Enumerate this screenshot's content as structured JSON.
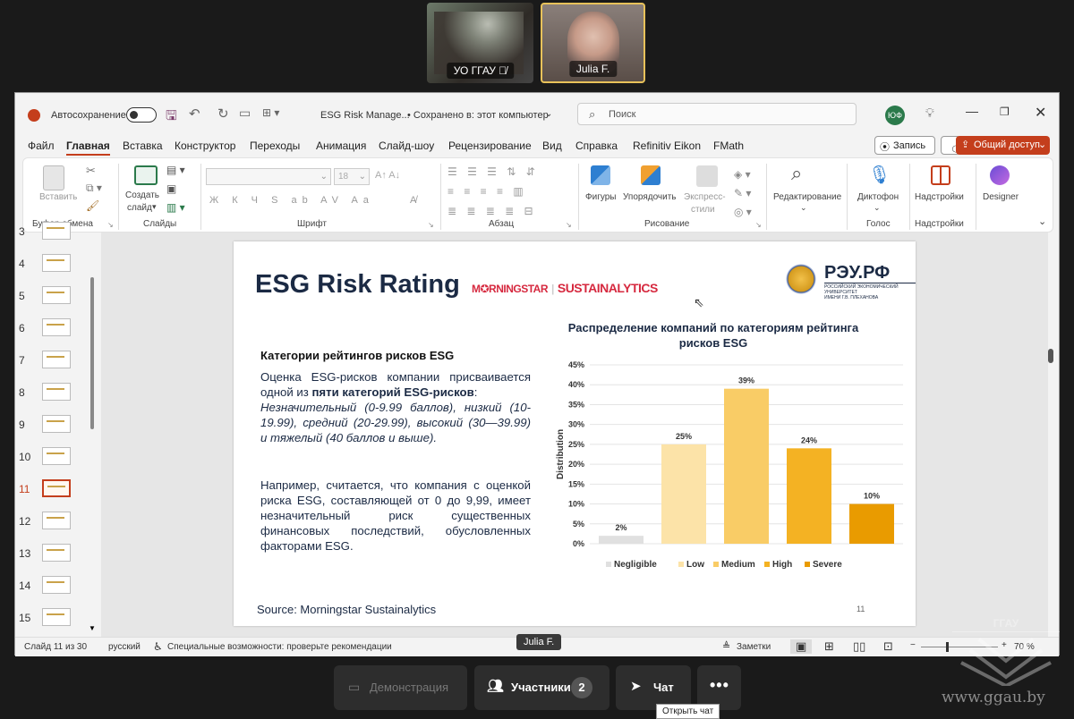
{
  "participants": [
    {
      "name": "УО ГГАУ"
    },
    {
      "name": "Julia F."
    }
  ],
  "titlebar": {
    "autosave": "Автосохранение",
    "filename": "ESG Risk Manage...",
    "saved": "• Сохранено в: этот компьютер",
    "search_placeholder": "Поиск",
    "avatar": "ЮФ"
  },
  "menu": [
    "Файл",
    "Главная",
    "Вставка",
    "Конструктор",
    "Переходы",
    "Анимация",
    "Слайд-шоу",
    "Рецензирование",
    "Вид",
    "Справка",
    "Refinitiv Eikon",
    "FMath"
  ],
  "record_label": "Запись",
  "share_label": "Общий доступ",
  "ribbon": {
    "paste": "Вставить",
    "clipboard": "Буфер обмена",
    "new_slide_1": "Создать",
    "new_slide_2": "слайд",
    "slides": "Слайды",
    "font_size": "18",
    "font_group": "Шрифт",
    "paragraph": "Абзац",
    "shapes": "Фигуры",
    "arrange": "Упорядочить",
    "express_1": "Экспресс-",
    "express_2": "стили",
    "drawing": "Рисование",
    "editing": "Редактирование",
    "dictate": "Диктофон",
    "voice": "Голос",
    "addins": "Надстройки",
    "addins_group": "Надстройки",
    "designer": "Designer"
  },
  "thumbs": [
    "3",
    "4",
    "5",
    "6",
    "7",
    "8",
    "9",
    "10",
    "11",
    "12",
    "13",
    "14",
    "15"
  ],
  "slide": {
    "title": "ESG Risk Rating",
    "logo_morningstar": "M✪RNINGSTAR",
    "logo_sustain": "SUSTAINALYTICS",
    "logo_reu": "РЭУ.РФ",
    "logo_reu_sub1": "РОССИЙСКИЙ ЭКОНОМИЧЕСКИЙ УНИВЕРСИТЕТ",
    "logo_reu_sub2": "ИМЕНИ Г.В. ПЛЕХАНОВА",
    "heading": "Категории рейтингов рисков ESG",
    "p1a": "Оценка ESG-рисков компании присваивается одной из ",
    "p1b": "пяти категорий ESG-рисков",
    "p1c": ":",
    "p1d": "Незначительный (0-9.99 баллов), низкий (10-19.99), средний (20-29.99), высокий (30—39.99) и тяжелый (40 баллов и выше).",
    "p2": "Например, считается, что компания с оценкой риска ESG, составляющей от 0 до 9,99, имеет незначительный риск существенных финансовых последствий, обусловленных факторами ESG.",
    "source": "Source: Morningstar Sustainalytics",
    "page": "11"
  },
  "chart_data": {
    "type": "bar",
    "title": "Распределение компаний по категориям рейтинга рисков ESG",
    "ylabel": "Distribution",
    "categories": [
      "Negligible",
      "Low",
      "Medium",
      "High",
      "Severe"
    ],
    "values": [
      2,
      25,
      39,
      24,
      10
    ],
    "data_labels": [
      "2%",
      "25%",
      "39%",
      "24%",
      "10%"
    ],
    "ylim": [
      0,
      45
    ],
    "yticks": [
      "0%",
      "5%",
      "10%",
      "15%",
      "20%",
      "25%",
      "30%",
      "35%",
      "40%",
      "45%"
    ],
    "colors": [
      "#e0e0e0",
      "#fce3a8",
      "#f9cc66",
      "#f4b223",
      "#e99b00"
    ],
    "grid": true,
    "legend": "bottom"
  },
  "status": {
    "slide": "Слайд 11 из 30",
    "lang": "русский",
    "access": "Специальные возможности: проверьте рекомендации",
    "notes": "Заметки",
    "zoom": "70 %",
    "speaker": "Julia F."
  },
  "controls": {
    "demo": "Демонстрация",
    "participants": "Участники",
    "count": "2",
    "chat": "Чат",
    "tooltip": "Открыть чат"
  },
  "watermark": {
    "site": "www.ggau.by",
    "logo_text": "ГГАУ"
  }
}
